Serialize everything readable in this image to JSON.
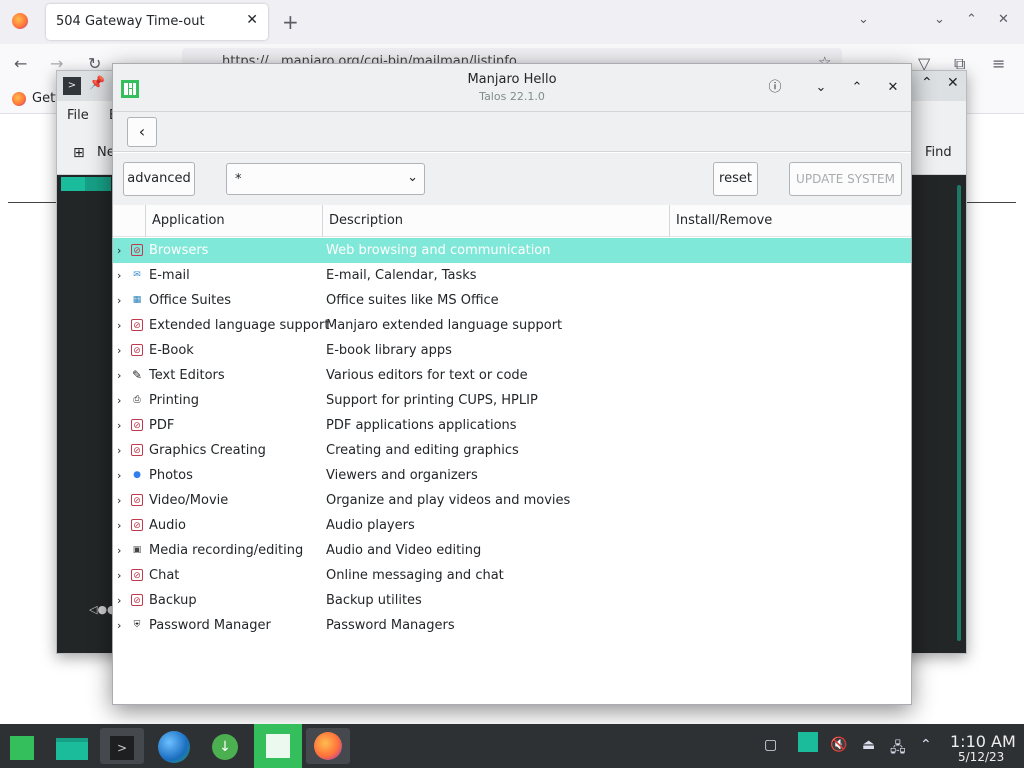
{
  "firefox": {
    "tab_title": "504 Gateway Time-out",
    "url_text": "https://...manjaro.org/cgi-bin/mailman/listinfo",
    "bookmark_get": "Getti"
  },
  "terminal": {
    "menu_file": "File",
    "menu_edit": "E",
    "tool_new": "Ne",
    "find_label": "Find"
  },
  "hello": {
    "title": "Manjaro Hello",
    "subtitle": "Talos 22.1.0",
    "advanced_label": "advanced",
    "filter_value": "*",
    "reset_label": "reset",
    "update_label": "UPDATE SYSTEM",
    "columns": [
      "Application",
      "Description",
      "Install/Remove"
    ],
    "rows": [
      {
        "name": "Browsers",
        "desc": "Web browsing and communication",
        "icon": "na-icon"
      },
      {
        "name": "E-mail",
        "desc": "E-mail, Calendar, Tasks",
        "icon": "email-icon"
      },
      {
        "name": "Office Suites",
        "desc": "Office suites like MS Office",
        "icon": "office-icon"
      },
      {
        "name": "Extended language support",
        "desc": "Manjaro extended language support",
        "icon": "na-icon"
      },
      {
        "name": "E-Book",
        "desc": "E-book library apps",
        "icon": "na-icon"
      },
      {
        "name": "Text Editors",
        "desc": "Various editors for text or code",
        "icon": "edit-icon"
      },
      {
        "name": "Printing",
        "desc": "Support for printing CUPS, HPLIP",
        "icon": "printer-icon"
      },
      {
        "name": "PDF",
        "desc": "PDF applications applications",
        "icon": "na-icon"
      },
      {
        "name": "Graphics Creating",
        "desc": "Creating and editing graphics",
        "icon": "na-icon"
      },
      {
        "name": "Photos",
        "desc": "Viewers and organizers",
        "icon": "photos-icon"
      },
      {
        "name": "Video/Movie",
        "desc": "Organize and play videos and movies",
        "icon": "na-icon"
      },
      {
        "name": "Audio",
        "desc": "Audio players",
        "icon": "na-icon"
      },
      {
        "name": "Media recording/editing",
        "desc": "Audio and Video editing",
        "icon": "media-icon"
      },
      {
        "name": "Chat",
        "desc": "Online messaging and chat",
        "icon": "na-icon"
      },
      {
        "name": "Backup",
        "desc": "Backup utilites",
        "icon": "na-icon"
      },
      {
        "name": "Password Manager",
        "desc": "Password Managers",
        "icon": "shield-icon"
      }
    ],
    "selected_index": 0
  },
  "taskbar": {
    "time": "1:10 AM",
    "date": "5/12/23"
  },
  "colors": {
    "selection": "#80e8d8",
    "manjaro_green": "#35bf5c",
    "taskbar": "#2e3134"
  }
}
